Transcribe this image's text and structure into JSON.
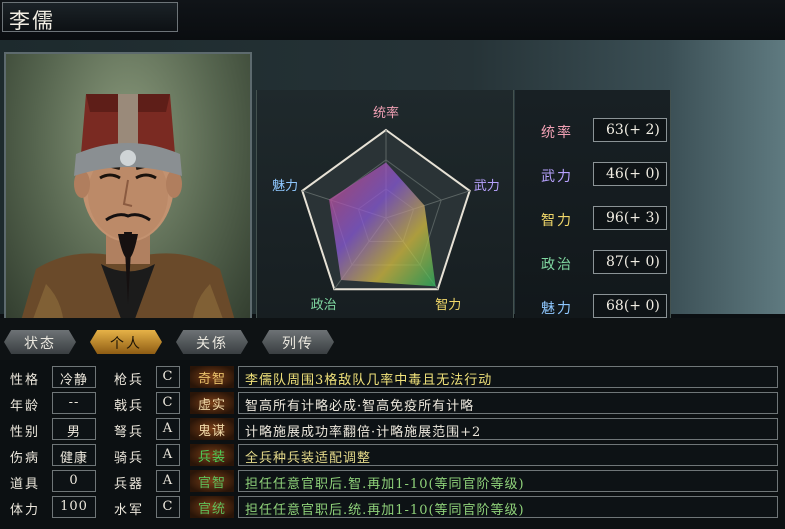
{
  "character": {
    "name": "李儒"
  },
  "radar": {
    "labels": {
      "lead": "统率",
      "war": "武力",
      "int": "智力",
      "pol": "政治",
      "chr": "魅力"
    },
    "values": {
      "lead": 63,
      "war": 46,
      "int": 96,
      "pol": 87,
      "chr": 68
    },
    "max": 100
  },
  "stats": [
    {
      "label": "统率",
      "value": "63(+ 2)",
      "color": "#f0a0b4"
    },
    {
      "label": "武力",
      "value": "46(+ 0)",
      "color": "#b8a2ff"
    },
    {
      "label": "智力",
      "value": "96(+ 3)",
      "color": "#f1d86a"
    },
    {
      "label": "政治",
      "value": "87(+ 0)",
      "color": "#7fd6a0"
    },
    {
      "label": "魅力",
      "value": "68(+ 0)",
      "color": "#8fc8ff"
    }
  ],
  "tabs": [
    {
      "label": "状态",
      "active": false
    },
    {
      "label": "个人",
      "active": true
    },
    {
      "label": "关係",
      "active": false
    },
    {
      "label": "列传",
      "active": false
    }
  ],
  "personal": [
    {
      "label": "性格",
      "value": "冷静"
    },
    {
      "label": "年龄",
      "value": "--"
    },
    {
      "label": "性别",
      "value": "男"
    },
    {
      "label": "伤病",
      "value": "健康"
    },
    {
      "label": "道具",
      "value": "0"
    },
    {
      "label": "体力",
      "value": "100"
    }
  ],
  "aptitudes": [
    {
      "label": "枪兵",
      "value": "C"
    },
    {
      "label": "戟兵",
      "value": "C"
    },
    {
      "label": "弩兵",
      "value": "A"
    },
    {
      "label": "骑兵",
      "value": "A"
    },
    {
      "label": "兵器",
      "value": "A"
    },
    {
      "label": "水军",
      "value": "C"
    }
  ],
  "skills": [
    {
      "tag": "奇智",
      "desc": "李儒队周围3格敌队几率中毒且无法行动",
      "color": "#f1e27a",
      "tagColor": "#e8c06a"
    },
    {
      "tag": "虚实",
      "desc": "智高所有计略必成·智高免疫所有计略",
      "color": "#ece7dc",
      "tagColor": "#f0d9a8"
    },
    {
      "tag": "鬼谋",
      "desc": "计略施展成功率翻倍·计略施展范围+2",
      "color": "#ece7dc",
      "tagColor": "#f0d9a8"
    },
    {
      "tag": "兵装",
      "desc": "全兵种兵装适配调整",
      "color": "#e5d98a",
      "tagColor": "#4fcf58"
    },
    {
      "tag": "官智",
      "desc": "担任任意官职后.智.再加1-10(等同官阶等级)",
      "color": "#8fd27a",
      "tagColor": "#5fbf5a"
    },
    {
      "tag": "官统",
      "desc": "担任任意官职后.统.再加1-10(等同官阶等级)",
      "color": "#8fd27a",
      "tagColor": "#5fbf5a"
    }
  ]
}
